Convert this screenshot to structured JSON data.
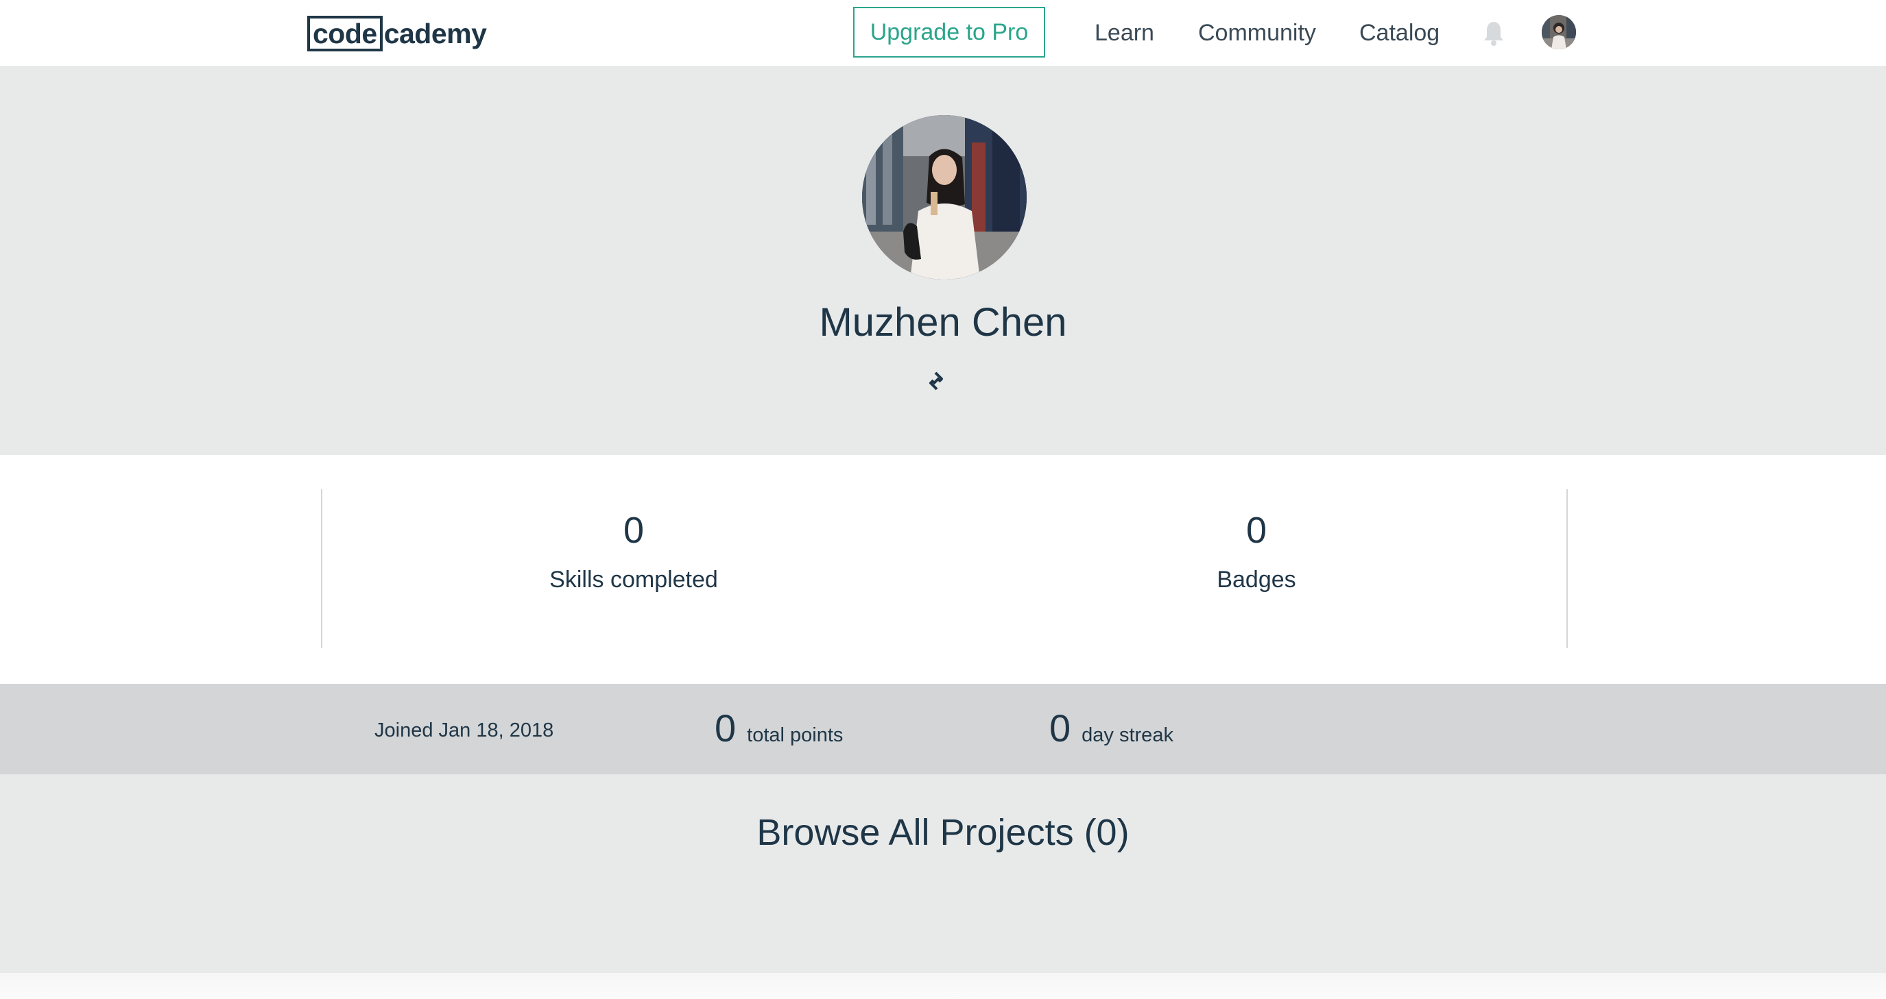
{
  "nav": {
    "logo_boxed": "code",
    "logo_rest": "cademy",
    "upgrade_label": "Upgrade to Pro",
    "links": [
      "Learn",
      "Community",
      "Catalog"
    ]
  },
  "profile": {
    "name": "Muzhen Chen"
  },
  "stats": {
    "skills_value": "0",
    "skills_label": "Skills completed",
    "badges_value": "0",
    "badges_label": "Badges"
  },
  "meta": {
    "joined": "Joined Jan 18, 2018",
    "points_value": "0",
    "points_label": "total points",
    "streak_value": "0",
    "streak_label": "day streak"
  },
  "projects": {
    "title": "Browse All Projects (0)"
  },
  "colors": {
    "brand_dark": "#1f3647",
    "accent_green": "#2aa58c",
    "header_bg": "#e8eaea",
    "meta_bg": "#d3d5d7"
  },
  "icons": {
    "notifications": "bell-icon",
    "profile_link": "link-icon"
  }
}
